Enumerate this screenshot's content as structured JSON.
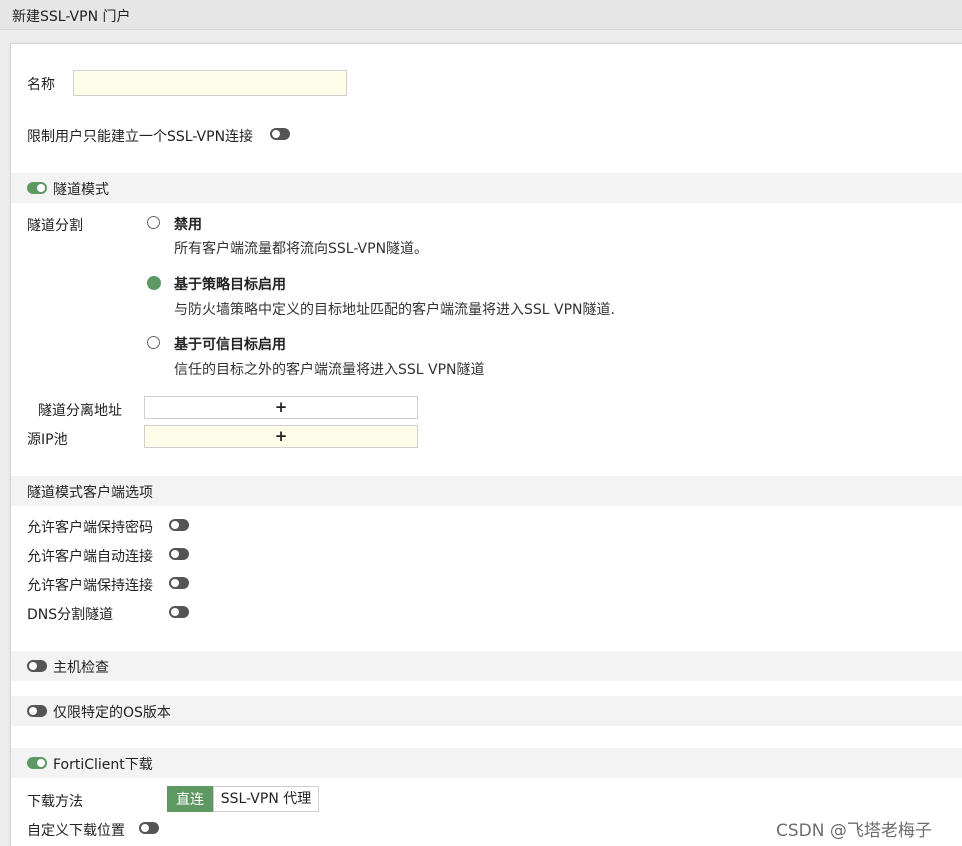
{
  "title": "新建SSL-VPN 门户",
  "name_label": "名称",
  "name_value": "",
  "limit_single_label": "限制用户只能建立一个SSL-VPN连接",
  "tunnel_mode": {
    "label": "隧道模式",
    "enabled": true,
    "split_label": "隧道分割",
    "options": [
      {
        "label": "禁用",
        "desc": "所有客户端流量都将流向SSL-VPN隧道。",
        "selected": false
      },
      {
        "label": "基于策略目标启用",
        "desc": "与防火墙策略中定义的目标地址匹配的客户端流量将进入SSL VPN隧道.",
        "selected": true
      },
      {
        "label": "基于可信目标启用",
        "desc": "信任的目标之外的客户端流量将进入SSL VPN隧道",
        "selected": false
      }
    ],
    "split_address_label": "隧道分离地址",
    "source_ip_pool_label": "源IP池",
    "add_symbol": "+"
  },
  "client_options": {
    "header": "隧道模式客户端选项",
    "items": [
      {
        "label": "允许客户端保持密码",
        "enabled": false
      },
      {
        "label": "允许客户端自动连接",
        "enabled": false
      },
      {
        "label": "允许客户端保持连接",
        "enabled": false
      },
      {
        "label": "DNS分割隧道",
        "enabled": false
      }
    ]
  },
  "host_check": {
    "label": "主机检查",
    "enabled": false
  },
  "os_restrict": {
    "label": "仅限特定的OS版本",
    "enabled": false
  },
  "forticlient": {
    "label": "FortiClient下载",
    "enabled": true,
    "method_label": "下载方法",
    "method_options": [
      "直连",
      "SSL-VPN 代理"
    ],
    "method_selected": "直连",
    "custom_location_label": "自定义下载位置",
    "custom_location_enabled": false
  },
  "watermark": "CSDN @飞塔老梅子",
  "colors": {
    "accent_green": "#5e9964",
    "toggle_off": "#555555",
    "input_yellow": "#fdfde9",
    "band_gray": "#f3f3f3"
  }
}
